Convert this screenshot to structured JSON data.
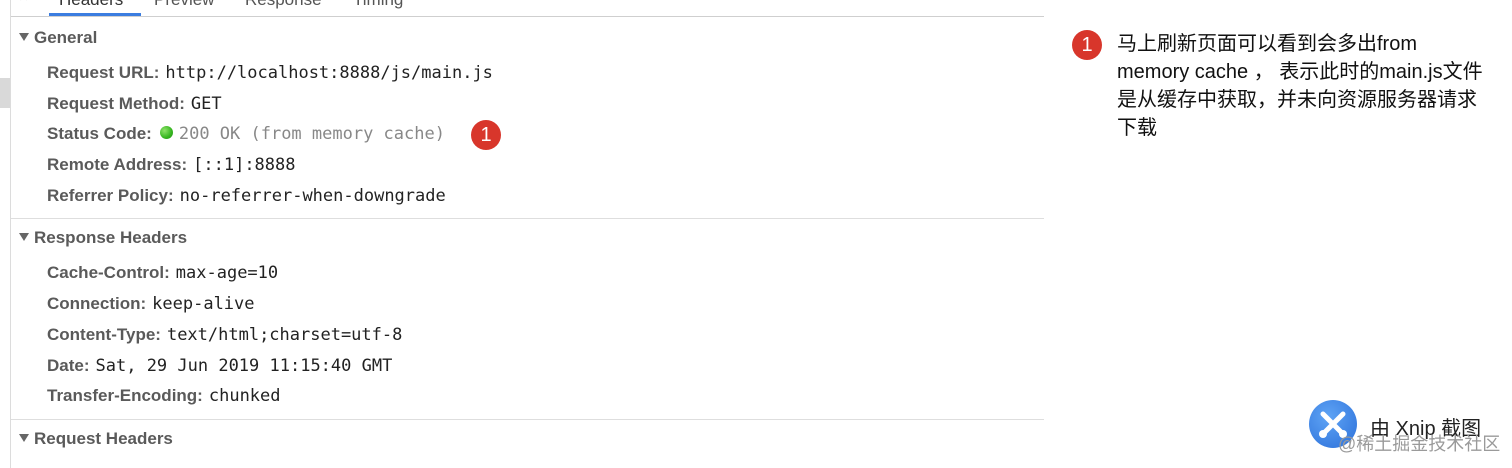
{
  "tabs": {
    "close": "×",
    "headers": "Headers",
    "preview": "Preview",
    "response": "Response",
    "timing": "Timing"
  },
  "general": {
    "title": "General",
    "rows": [
      {
        "key": "Request URL:",
        "value": "http://localhost:8888/js/main.js"
      },
      {
        "key": "Request Method:",
        "value": "GET"
      },
      {
        "key": "Status Code:",
        "value": "200 OK (from memory cache)"
      },
      {
        "key": "Remote Address:",
        "value": "[::1]:8888"
      },
      {
        "key": "Referrer Policy:",
        "value": "no-referrer-when-downgrade"
      }
    ],
    "status_badge": "1"
  },
  "response_headers": {
    "title": "Response Headers",
    "rows": [
      {
        "key": "Cache-Control:",
        "value": "max-age=10"
      },
      {
        "key": "Connection:",
        "value": "keep-alive"
      },
      {
        "key": "Content-Type:",
        "value": "text/html;charset=utf-8"
      },
      {
        "key": "Date:",
        "value": "Sat, 29 Jun 2019 11:15:40 GMT"
      },
      {
        "key": "Transfer-Encoding:",
        "value": "chunked"
      }
    ]
  },
  "request_headers": {
    "title": "Request Headers"
  },
  "annotation": {
    "badge": "1",
    "text": "马上刷新页面可以看到会多出from memory cache ， 表示此时的main.js文件是从缓存中获取，并未向资源服务器请求下载"
  },
  "watermark": {
    "xnip": "由 Xnip 截图",
    "juejin": "@稀土掘金技术社区"
  },
  "colors": {
    "accent": "#3b7de0",
    "badge": "#d8362b",
    "status_ok": "#35b51f"
  }
}
